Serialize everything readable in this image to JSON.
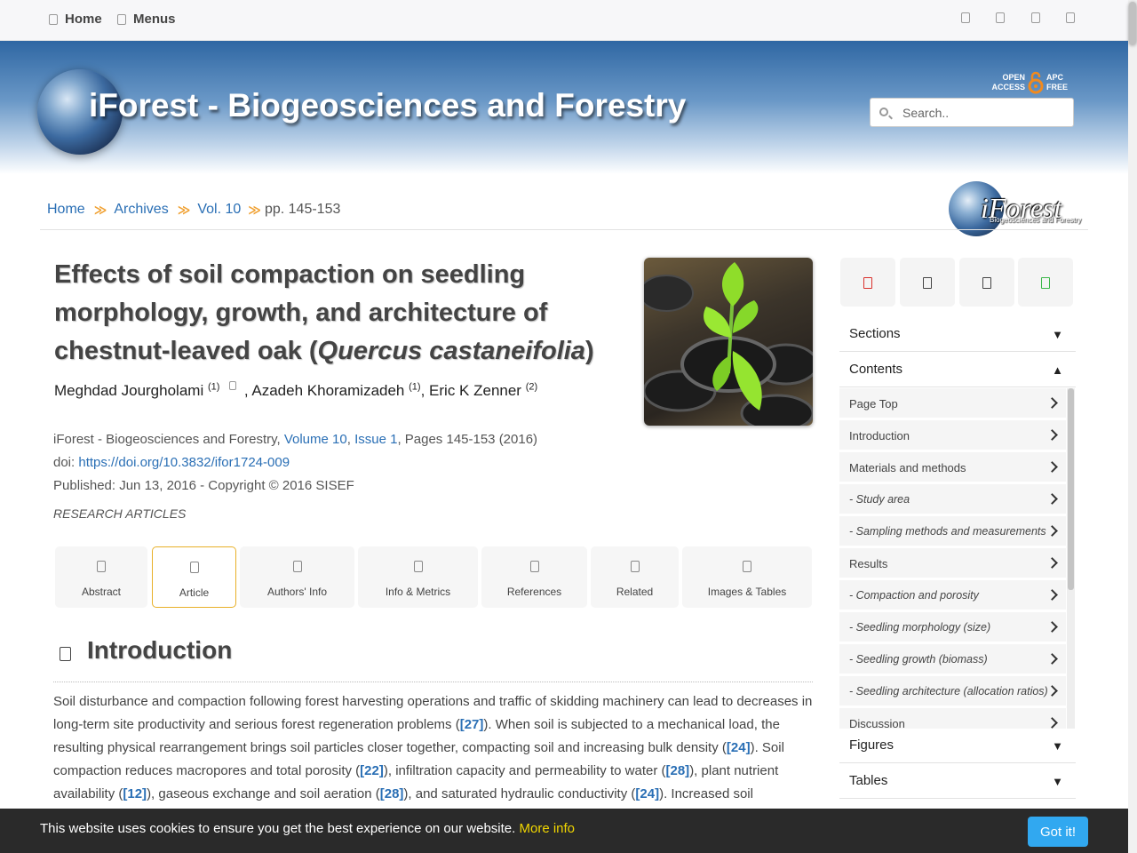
{
  "topnav": {
    "home": "Home",
    "menus": "Menus"
  },
  "header": {
    "site_title": "iForest - Biogeosciences and Forestry",
    "oa_left": [
      "OPEN",
      "ACCESS"
    ],
    "oa_right": [
      "APC",
      "FREE"
    ],
    "search_placeholder": "Search.."
  },
  "logo": {
    "text": "iForest",
    "subtitle": "Biogeosciences and Forestry"
  },
  "breadcrumb": {
    "items": [
      "Home",
      "Archives",
      "Vol. 10"
    ],
    "current": "pp. 145-153"
  },
  "article": {
    "title_main": "Effects of soil compaction on seedling morphology, growth, and architecture of chestnut-leaved oak (",
    "title_species": "Quercus castaneifolia",
    "title_end": ")",
    "authors": [
      {
        "name": "Meghdad Jourgholami",
        "aff": "(1)"
      },
      {
        "name": "Azadeh Khoramizadeh",
        "aff": "(1)"
      },
      {
        "name": "Eric K Zenner",
        "aff": "(2)"
      }
    ],
    "journal": "iForest - Biogeosciences and Forestry, ",
    "volume": "Volume 10",
    "issue": "Issue 1",
    "pages": ", Pages 145-153 (2016)",
    "doi_label": "doi: ",
    "doi": "https://doi.org/10.3832/ifor1724-009",
    "published": "Published: Jun 13, 2016 - Copyright © 2016 SISEF",
    "category": "RESEARCH ARTICLES"
  },
  "tabs": [
    "Abstract",
    "Article",
    "Authors' Info",
    "Info & Metrics",
    "References",
    "Related",
    "Images & Tables"
  ],
  "active_tab": "Article",
  "section": {
    "title": "Introduction",
    "text": [
      "Soil disturbance and compaction following forest harvesting operations and traffic of skidding machinery can lead to decreases in long-term site productivity and serious forest regeneration problems (",
      "[27]",
      "). When soil is subjected to a mechanical load, the resulting physical rearrangement brings soil particles closer together, compacting soil and increasing bulk density (",
      "[24]",
      "). Soil compaction reduces macropores and total porosity (",
      "[22]",
      "), infiltration capacity and permeability to water (",
      "[28]",
      "), plant nutrient availability (",
      "[12]",
      "), gaseous exchange and soil aeration (",
      "[28]",
      "), and saturated hydraulic conductivity (",
      "[24]",
      "). Increased soil compaction"
    ]
  },
  "sidebar": {
    "share_icon_colors": [
      "#d9302c",
      "#222222",
      "#222222",
      "#3cb84a"
    ],
    "sections": "Sections",
    "contents": "Contents",
    "toc": [
      {
        "label": "Page Top",
        "sub": false
      },
      {
        "label": "Introduction",
        "sub": false
      },
      {
        "label": "Materials and methods",
        "sub": false
      },
      {
        "label": "- Study area",
        "sub": true
      },
      {
        "label": "- Sampling methods and measurements",
        "sub": true
      },
      {
        "label": "Results",
        "sub": false
      },
      {
        "label": "- Compaction and porosity",
        "sub": true
      },
      {
        "label": "- Seedling morphology (size)",
        "sub": true
      },
      {
        "label": "- Seedling growth (biomass)",
        "sub": true
      },
      {
        "label": "- Seedling architecture (allocation ratios)",
        "sub": true
      },
      {
        "label": "Discussion",
        "sub": false
      }
    ],
    "figures": "Figures",
    "tables": "Tables",
    "tri_down": "▼",
    "tri_up": "▲"
  },
  "cookie": {
    "text": "This website uses cookies to ensure you get the best experience on our website. ",
    "more": "More info",
    "button": "Got it!"
  }
}
